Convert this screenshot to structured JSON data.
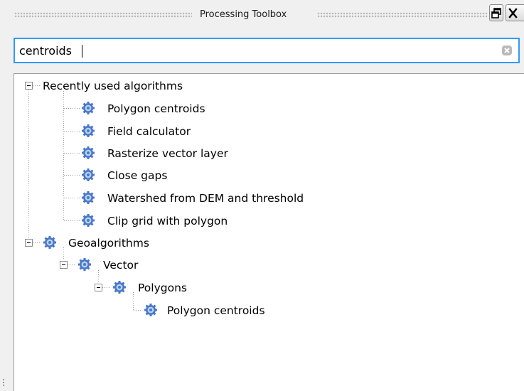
{
  "window": {
    "title": "Processing Toolbox",
    "float_button": "float-icon",
    "close_button": "close-icon"
  },
  "search": {
    "value": "centroids",
    "clear_icon": "clear-icon"
  },
  "tree": {
    "recent": {
      "label": "Recently used algorithms",
      "items": [
        "Polygon centroids",
        "Field calculator",
        "Rasterize vector layer",
        "Close gaps",
        "Watershed from DEM and threshold",
        "Clip grid with polygon"
      ]
    },
    "geo": {
      "label": "Geoalgorithms",
      "vector": {
        "label": "Vector",
        "polygons": {
          "label": "Polygons",
          "item": "Polygon centroids"
        }
      }
    }
  },
  "colors": {
    "focus_border": "#3399ff",
    "gear_icon": "#4a78c8"
  }
}
